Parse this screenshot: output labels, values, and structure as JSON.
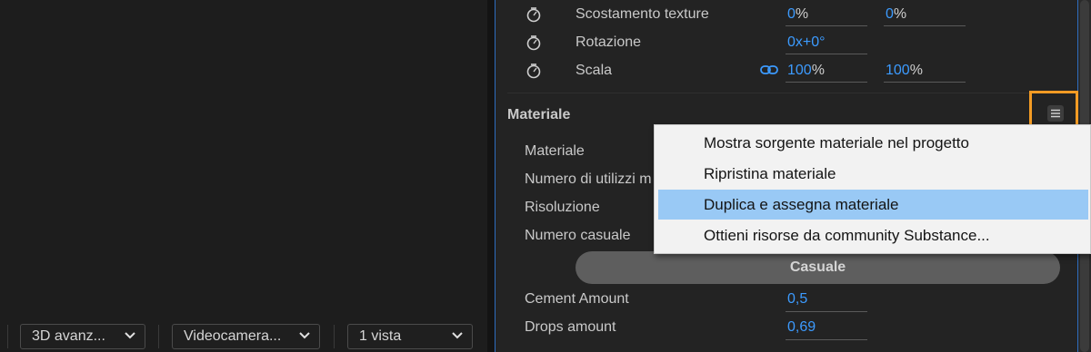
{
  "viewer_bar": {
    "renderer": "3D avanz...",
    "camera": "Videocamera...",
    "view": "1 vista"
  },
  "transform": {
    "rows": [
      {
        "label": "Scostamento texture",
        "v1": "0",
        "u1": "%",
        "v2": "0",
        "u2": "%"
      },
      {
        "label": "Rotazione",
        "v1": "0x",
        "rest": "+0°"
      },
      {
        "label": "Scala",
        "v1": "100",
        "u1": "%",
        "v2": "100",
        "u2": "%"
      }
    ]
  },
  "material_section": {
    "title": "Materiale",
    "labels": [
      "Materiale",
      "Numero di utilizzi m",
      "Risoluzione",
      "Numero casuale"
    ],
    "random_button": "Casuale",
    "params": [
      {
        "label": "Cement Amount",
        "value": "0,5"
      },
      {
        "label": "Drops amount",
        "value": "0,69"
      }
    ]
  },
  "context_menu": {
    "items": [
      "Mostra sorgente materiale nel progetto",
      "Ripristina materiale",
      "Duplica e assegna materiale",
      "Ottieni risorse da community Substance..."
    ],
    "highlighted_index": 2
  },
  "colors": {
    "accent_blue": "#3c9bff",
    "highlight_orange": "#f39b24",
    "menu_hover": "#99c9f5"
  },
  "icons": [
    "stopwatch-icon",
    "link-icon",
    "panel-menu-icon",
    "chevron-down-icon"
  ]
}
